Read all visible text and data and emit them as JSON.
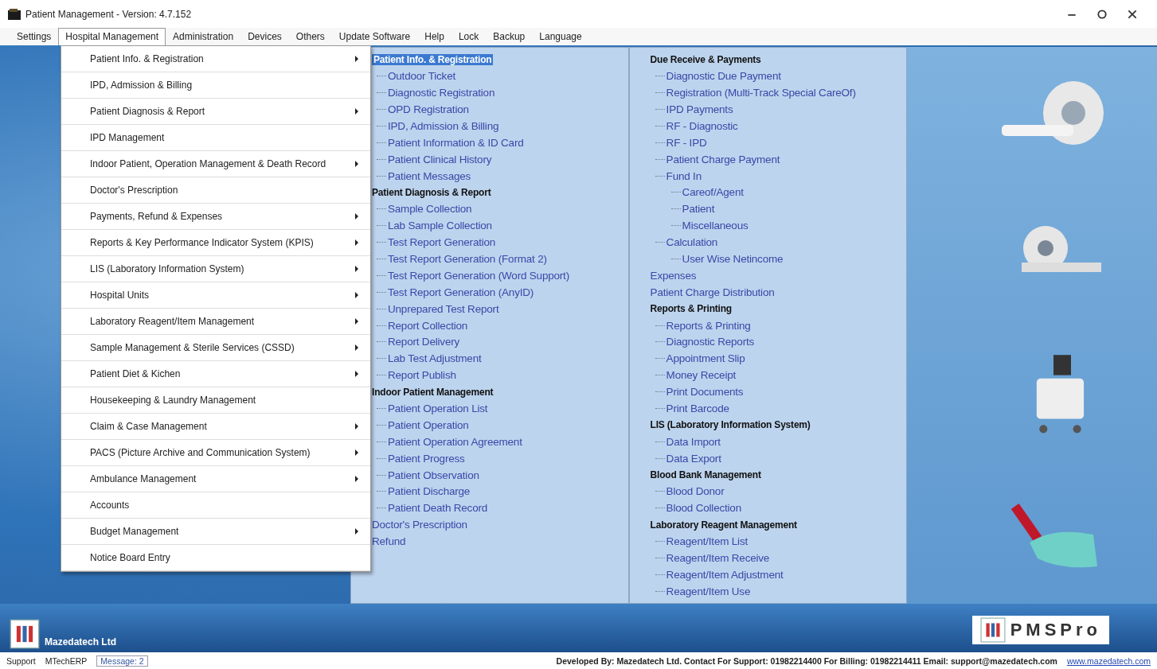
{
  "window": {
    "title": "Patient Management - Version: 4.7.152"
  },
  "menu_bar": [
    {
      "label": "Settings",
      "selected": false
    },
    {
      "label": "Hospital Management",
      "selected": true
    },
    {
      "label": "Administration",
      "selected": false
    },
    {
      "label": "Devices",
      "selected": false
    },
    {
      "label": "Others",
      "selected": false
    },
    {
      "label": "Update Software",
      "selected": false
    },
    {
      "label": "Help",
      "selected": false
    },
    {
      "label": "Lock",
      "selected": false
    },
    {
      "label": "Backup",
      "selected": false
    },
    {
      "label": "Language",
      "selected": false
    }
  ],
  "dropdown": [
    {
      "label": "Patient Info. & Registration",
      "has_submenu": true
    },
    {
      "label": "IPD, Admission & Billing",
      "has_submenu": false
    },
    {
      "label": "Patient Diagnosis & Report",
      "has_submenu": true
    },
    {
      "label": "IPD Management",
      "has_submenu": false
    },
    {
      "label": "Indoor Patient, Operation Management & Death Record",
      "has_submenu": true
    },
    {
      "label": "Doctor's Prescription",
      "has_submenu": false
    },
    {
      "label": "Payments, Refund & Expenses",
      "has_submenu": true
    },
    {
      "label": "Reports & Key Performance Indicator System (KPIS)",
      "has_submenu": true
    },
    {
      "label": "LIS (Laboratory Information System)",
      "has_submenu": true
    },
    {
      "label": "Hospital Units",
      "has_submenu": true
    },
    {
      "label": "Laboratory Reagent/Item Management",
      "has_submenu": true
    },
    {
      "label": "Sample Management & Sterile Services (CSSD)",
      "has_submenu": true
    },
    {
      "label": "Patient Diet & Kichen",
      "has_submenu": true
    },
    {
      "label": "Housekeeping & Laundry Management",
      "has_submenu": false
    },
    {
      "label": "Claim & Case Management",
      "has_submenu": true
    },
    {
      "label": "PACS (Picture Archive and Communication System)",
      "has_submenu": true
    },
    {
      "label": "Ambulance Management",
      "has_submenu": true
    },
    {
      "label": "Accounts",
      "has_submenu": false
    },
    {
      "label": "Budget Management",
      "has_submenu": true
    },
    {
      "label": "Notice Board Entry",
      "has_submenu": false
    }
  ],
  "tree_columns": [
    {
      "nodes": [
        {
          "label": "Patient Info. & Registration",
          "selected": true,
          "children": [
            {
              "label": "Outdoor Ticket",
              "selected": false
            },
            {
              "label": "Diagnostic Registration",
              "selected": false
            },
            {
              "label": "OPD Registration",
              "selected": false
            },
            {
              "label": "IPD, Admission & Billing",
              "selected": false
            },
            {
              "label": "Patient Information & ID Card",
              "selected": false
            },
            {
              "label": "Patient Clinical History",
              "selected": false
            },
            {
              "label": "Patient Messages",
              "selected": false
            }
          ]
        },
        {
          "label": "Patient Diagnosis & Report",
          "selected": false,
          "children": [
            {
              "label": "Sample Collection",
              "selected": false
            },
            {
              "label": "Lab Sample Collection",
              "selected": false
            },
            {
              "label": "Test Report Generation",
              "selected": false
            },
            {
              "label": "Test Report Generation (Format 2)",
              "selected": false
            },
            {
              "label": "Test Report Generation (Word Support)",
              "selected": false
            },
            {
              "label": "Test Report Generation (AnyID)",
              "selected": false
            },
            {
              "label": "Unprepared Test Report",
              "selected": false
            },
            {
              "label": "Report Collection",
              "selected": false
            },
            {
              "label": "Report Delivery",
              "selected": false
            },
            {
              "label": "Lab Test Adjustment",
              "selected": false
            },
            {
              "label": "Report Publish",
              "selected": false
            }
          ]
        },
        {
          "label": "Indoor Patient Management",
          "selected": false,
          "children": [
            {
              "label": "Patient Operation List",
              "selected": false
            },
            {
              "label": "Patient Operation",
              "selected": false
            },
            {
              "label": "Patient Operation Agreement",
              "selected": false
            },
            {
              "label": "Patient Progress",
              "selected": false
            },
            {
              "label": "Patient Observation",
              "selected": false
            },
            {
              "label": "Patient Discharge",
              "selected": false
            },
            {
              "label": "Patient Death Record",
              "selected": false
            }
          ]
        },
        {
          "label": "Doctor's Prescription",
          "selected": false
        },
        {
          "label": "Refund",
          "selected": false
        }
      ]
    },
    {
      "nodes": [
        {
          "label": "Due Receive & Payments",
          "selected": false,
          "children": [
            {
              "label": "Diagnostic Due Payment",
              "selected": false
            },
            {
              "label": "Registration (Multi-Track Special CareOf)",
              "selected": false
            },
            {
              "label": "IPD Payments",
              "selected": false
            },
            {
              "label": "RF - Diagnostic",
              "selected": false
            },
            {
              "label": "RF - IPD",
              "selected": false
            },
            {
              "label": "Patient Charge Payment",
              "selected": false
            },
            {
              "label": "Fund In",
              "selected": false,
              "children": [
                {
                  "label": "Careof/Agent",
                  "selected": false
                },
                {
                  "label": "Patient",
                  "selected": false
                },
                {
                  "label": "Miscellaneous",
                  "selected": false
                }
              ]
            },
            {
              "label": "Calculation",
              "selected": false,
              "children": [
                {
                  "label": "User Wise Netincome",
                  "selected": false
                }
              ]
            }
          ]
        },
        {
          "label": "Expenses",
          "selected": false
        },
        {
          "label": "Patient Charge Distribution",
          "selected": false
        },
        {
          "label": "Reports & Printing",
          "selected": false,
          "children": [
            {
              "label": "Reports & Printing",
              "selected": false
            },
            {
              "label": "Diagnostic Reports",
              "selected": false
            },
            {
              "label": "Appointment Slip",
              "selected": false
            },
            {
              "label": "Money Receipt",
              "selected": false
            },
            {
              "label": "Print Documents",
              "selected": false
            },
            {
              "label": "Print Barcode",
              "selected": false
            }
          ]
        },
        {
          "label": "LIS (Laboratory Information System)",
          "selected": false,
          "children": [
            {
              "label": "Data Import",
              "selected": false
            },
            {
              "label": "Data Export",
              "selected": false
            }
          ]
        },
        {
          "label": "Blood Bank Management",
          "selected": false,
          "children": [
            {
              "label": "Blood Donor",
              "selected": false
            },
            {
              "label": "Blood Collection",
              "selected": false
            }
          ]
        },
        {
          "label": "Laboratory Reagent Management",
          "selected": false,
          "children": [
            {
              "label": "Reagent/Item List",
              "selected": false
            },
            {
              "label": "Reagent/Item Receive",
              "selected": false
            },
            {
              "label": "Reagent/Item Adjustment",
              "selected": false
            },
            {
              "label": "Reagent/Item Use",
              "selected": false
            }
          ]
        }
      ]
    }
  ],
  "footer": {
    "company": "Mazedatech Ltd",
    "product": "PMSPro"
  },
  "status_bar": {
    "support": "Support",
    "erp": "MTechERP",
    "message": "Message: 2",
    "credits": "Developed By: Mazedatech Ltd. Contact For Support: 01982214400 For Billing: 01982214411 Email: support@mazedatech.com",
    "website": "www.mazedatech.com"
  }
}
